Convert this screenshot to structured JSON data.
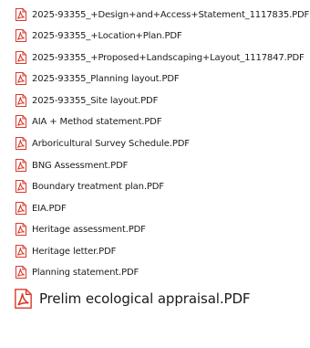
{
  "files": [
    {
      "name": "2025-93355_+Design+and+Access+Statement_1117835.PDF",
      "icon": "pdf-file-icon"
    },
    {
      "name": "2025-93355_+Location+Plan.PDF",
      "icon": "pdf-file-icon"
    },
    {
      "name": "2025-93355_+Proposed+Landscaping+Layout_1117847.PDF",
      "icon": "pdf-file-icon"
    },
    {
      "name": "2025-93355_Planning layout.PDF",
      "icon": "pdf-file-icon"
    },
    {
      "name": "2025-93355_Site layout.PDF",
      "icon": "pdf-file-icon"
    },
    {
      "name": "AIA + Method statement.PDF",
      "icon": "pdf-file-icon"
    },
    {
      "name": "Arboricultural Survey Schedule.PDF",
      "icon": "pdf-file-icon"
    },
    {
      "name": "BNG Assessment.PDF",
      "icon": "pdf-file-icon"
    },
    {
      "name": "Boundary treatment plan.PDF",
      "icon": "pdf-file-icon"
    },
    {
      "name": "EIA.PDF",
      "icon": "pdf-file-icon"
    },
    {
      "name": "Heritage assessment.PDF",
      "icon": "pdf-file-icon"
    },
    {
      "name": "Heritage letter.PDF",
      "icon": "pdf-file-icon"
    },
    {
      "name": "Planning statement.PDF",
      "icon": "pdf-file-icon"
    },
    {
      "name": "Prelim ecological appraisal.PDF",
      "icon": "pdf-file-icon"
    }
  ],
  "colors": {
    "icon_red": "#d93a2b",
    "icon_paper": "#ffffff",
    "text": "#1c1c1c"
  }
}
